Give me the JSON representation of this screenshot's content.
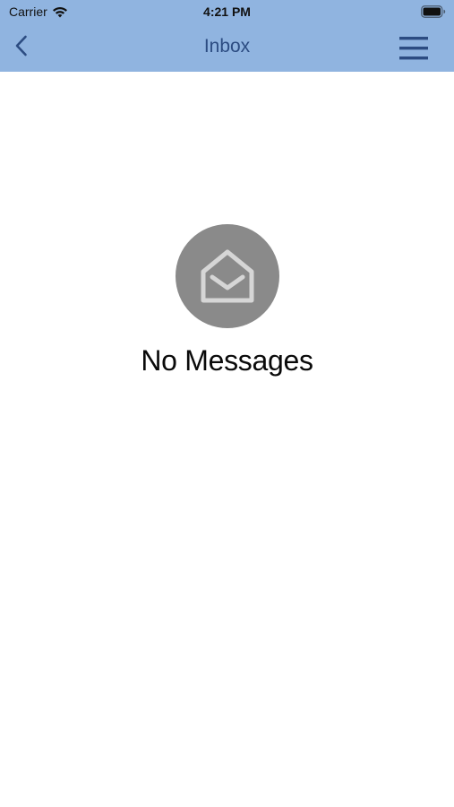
{
  "status_bar": {
    "carrier": "Carrier",
    "time": "4:21 PM",
    "wifi_icon": "wifi-icon",
    "battery_icon": "battery-icon"
  },
  "nav_bar": {
    "title": "Inbox",
    "back_icon": "chevron-left-icon",
    "menu_icon": "hamburger-menu-icon",
    "background_color": "#90b4e0",
    "tint_color": "#2c4c82"
  },
  "empty_state": {
    "icon": "open-envelope-icon",
    "message": "No Messages"
  }
}
